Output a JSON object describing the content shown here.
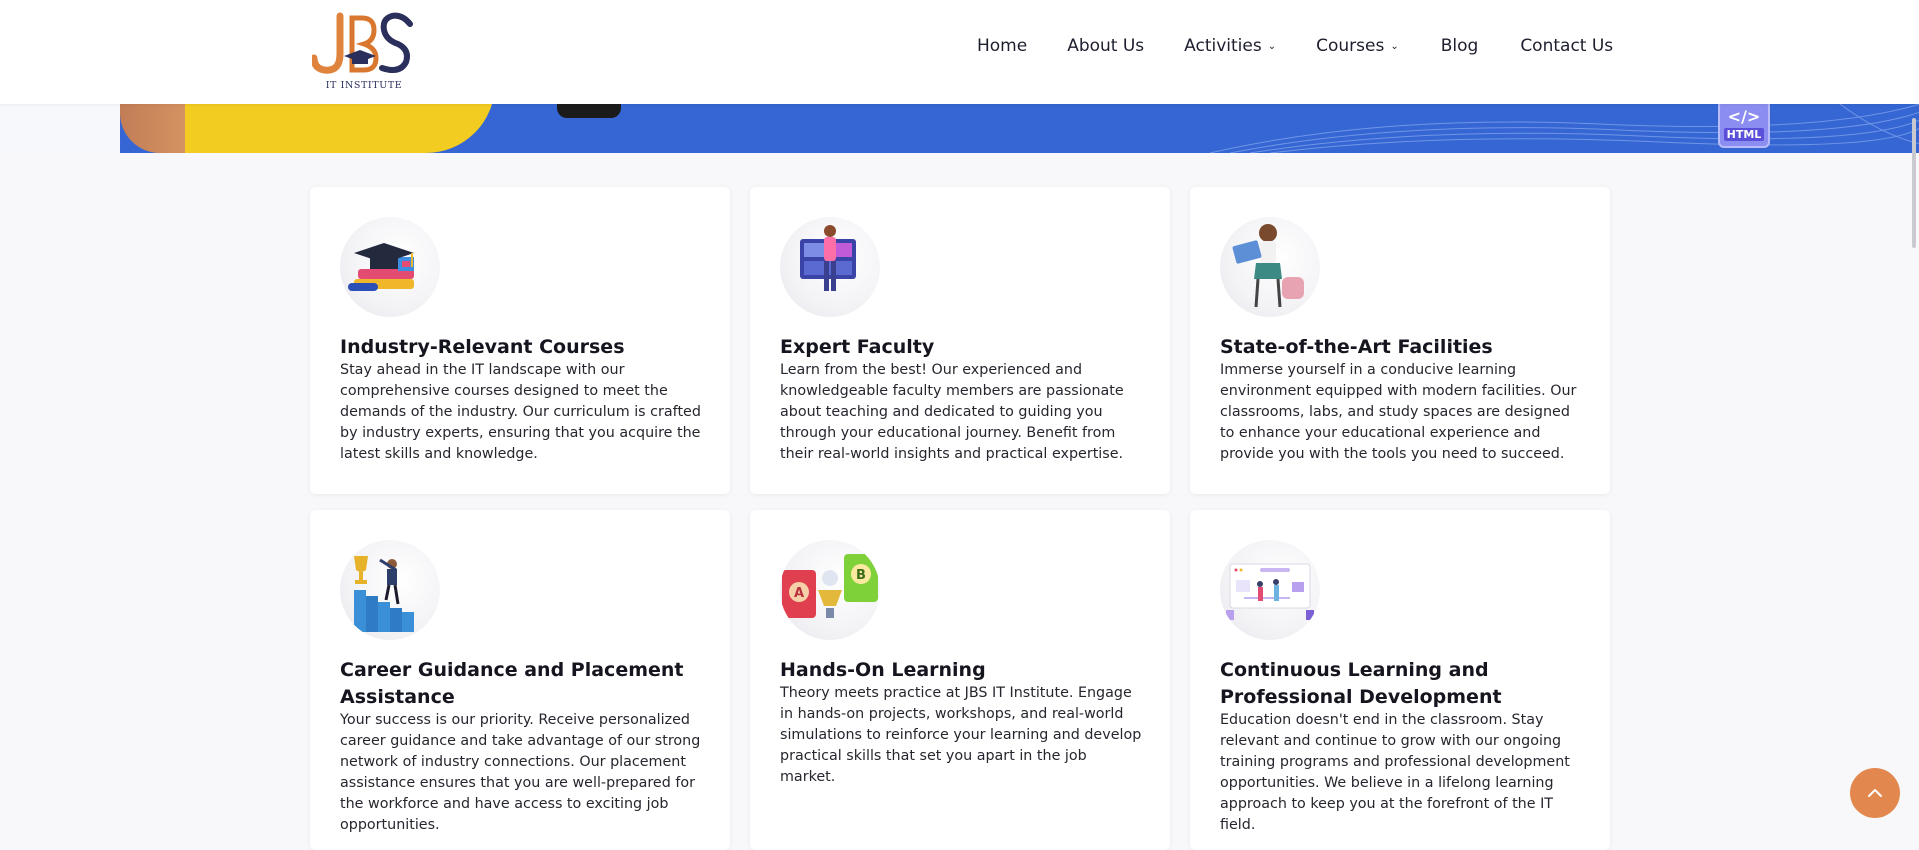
{
  "brand": {
    "logo_letters": "JBS",
    "logo_subtitle": "IT INSTITUTE"
  },
  "nav": {
    "items": [
      {
        "label": "Home",
        "dropdown": false
      },
      {
        "label": "About Us",
        "dropdown": false
      },
      {
        "label": "Activities",
        "dropdown": true
      },
      {
        "label": "Courses",
        "dropdown": true
      },
      {
        "label": "Blog",
        "dropdown": false
      },
      {
        "label": "Contact Us",
        "dropdown": false
      }
    ]
  },
  "hero": {
    "badge_code": "</>",
    "badge_label": "HTML"
  },
  "features": [
    {
      "title": "Industry-Relevant Courses",
      "text": "Stay ahead in the IT landscape with our comprehensive courses designed to meet the demands of the industry. Our curriculum is crafted by industry experts, ensuring that you acquire the latest skills and knowledge.",
      "icon": "graduation-books-icon"
    },
    {
      "title": "Expert Faculty",
      "text": "Learn from the best! Our experienced and knowledgeable faculty members are passionate about teaching and dedicated to guiding you through your educational journey. Benefit from their real-world insights and practical expertise.",
      "icon": "teacher-board-icon"
    },
    {
      "title": "State-of-the-Art Facilities",
      "text": "Immerse yourself in a conducive learning environment equipped with modern facilities. Our classrooms, labs, and study spaces are designed to enhance your educational experience and provide you with the tools you need to succeed.",
      "icon": "student-laptop-icon"
    },
    {
      "title": "Career Guidance and Placement Assistance",
      "text": "Your success is our priority. Receive personalized career guidance and take advantage of our strong network of industry connections. Our placement assistance ensures that you are well-prepared for the workforce and have access to exciting job opportunities.",
      "icon": "career-trophy-icon"
    },
    {
      "title": "Hands-On Learning",
      "text": "Theory meets practice at JBS IT Institute. Engage in hands-on projects, workshops, and real-world simulations to reinforce your learning and develop practical skills that set you apart in the job market.",
      "icon": "ab-testing-icon"
    },
    {
      "title": "Continuous Learning and Professional Development",
      "text": "Education doesn't end in the classroom. Stay relevant and continue to grow with our ongoing training programs and professional development opportunities. We believe in a lifelong learning approach to keep you at the forefront of the IT field.",
      "icon": "team-dashboard-icon"
    }
  ],
  "colors": {
    "accent_orange": "#e2884e",
    "brand_navy": "#2a2f5c",
    "hero_blue": "#3566d3"
  }
}
